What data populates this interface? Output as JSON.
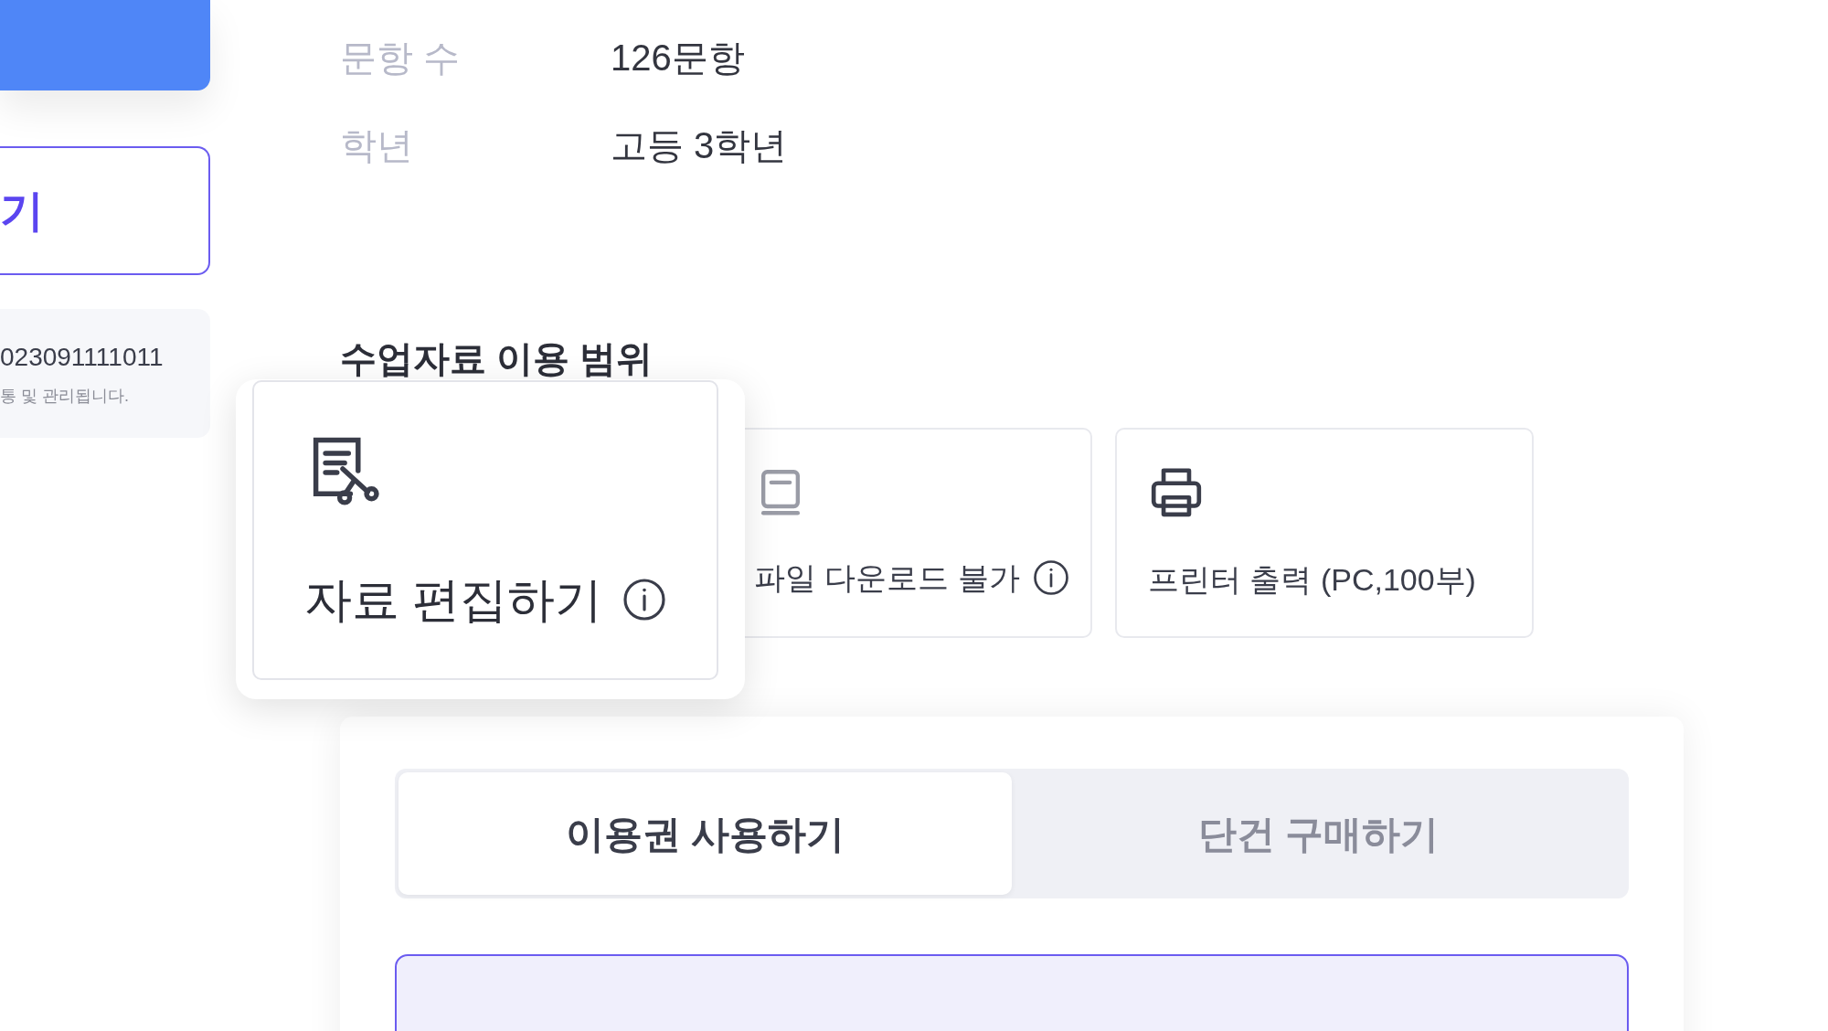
{
  "sidebar": {
    "outline_button": {
      "label": "기"
    },
    "info_box": {
      "code": "023091111011",
      "note": "통 및 관리됩니다."
    }
  },
  "details": [
    {
      "label": "문항 수",
      "value": "126문항"
    },
    {
      "label": "학년",
      "value": "고등 3학년"
    }
  ],
  "usage_scope": {
    "title": "수업자료 이용 범위",
    "items": [
      {
        "kind": "edit",
        "label": "자료 편집하기",
        "info": true,
        "highlighted": true
      },
      {
        "kind": "download",
        "label": "파일 다운로드 불가",
        "info": true,
        "highlighted": false
      },
      {
        "kind": "print",
        "label": "프린터 출력 (PC,100부)",
        "info": false,
        "highlighted": false
      }
    ]
  },
  "purchase_tabs": [
    {
      "label": "이용권 사용하기",
      "selected": true
    },
    {
      "label": "단건 구매하기",
      "selected": false
    }
  ]
}
